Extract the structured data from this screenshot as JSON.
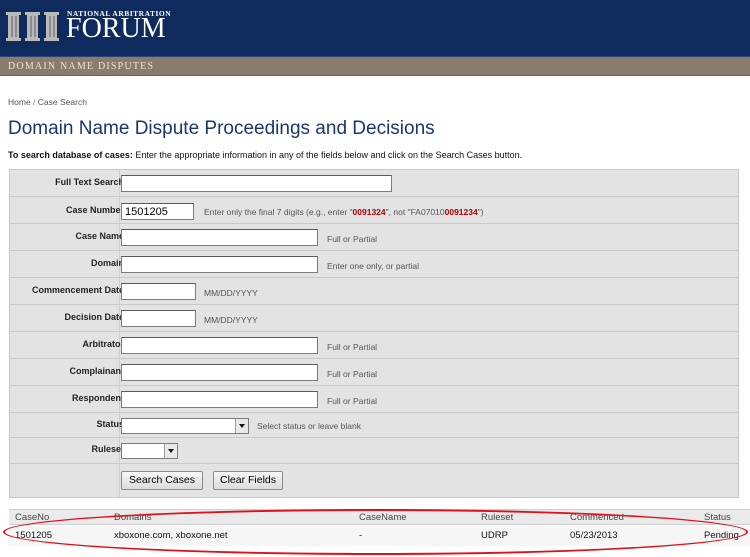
{
  "header": {
    "org_small": "NATIONAL ARBITRATION",
    "org_big": "FORUM",
    "section": "DOMAIN NAME DISPUTES"
  },
  "breadcrumb": {
    "home": "Home",
    "sep": " / ",
    "current": "Case Search"
  },
  "page": {
    "title": "Domain Name Dispute Proceedings and Decisions",
    "intro_bold": "To search database of cases:",
    "intro_text": " Enter the appropriate information in any of the fields below and click on the Search Cases button."
  },
  "form": {
    "full_text": {
      "label": "Full Text Search",
      "value": ""
    },
    "case_number": {
      "label": "Case Number",
      "value": "1501205",
      "hint_a": "Enter only the final 7 digits (e.g., enter \"",
      "hint_red1": "0091324",
      "hint_b": "\", not \"FA07010",
      "hint_red2": "0091234",
      "hint_c": "\")"
    },
    "case_name": {
      "label": "Case Name",
      "value": "",
      "hint": "Full or Partial"
    },
    "domain": {
      "label": "Domain",
      "value": "",
      "hint": "Enter one only, or partial"
    },
    "commencement": {
      "label": "Commencement Date",
      "value": "",
      "hint": "MM/DD/YYYY"
    },
    "decision": {
      "label": "Decision Date",
      "value": "",
      "hint": "MM/DD/YYYY"
    },
    "arbitrator": {
      "label": "Arbitrator",
      "value": "",
      "hint": "Full or Partial"
    },
    "complainant": {
      "label": "Complainant",
      "value": "",
      "hint": "Full or Partial"
    },
    "respondent": {
      "label": "Respondent",
      "value": "",
      "hint": "Full or Partial"
    },
    "status": {
      "label": "Status",
      "value": "",
      "hint": "Select status or leave blank"
    },
    "ruleset": {
      "label": "Ruleset",
      "value": ""
    },
    "search_button": "Search Cases",
    "clear_button": "Clear Fields"
  },
  "results": {
    "columns": [
      "CaseNo",
      "Domains",
      "CaseName",
      "Ruleset",
      "Commenced",
      "Status"
    ],
    "rows": [
      {
        "case_no": "1501205",
        "domains": "xboxone.com, xboxone.net",
        "case_name": "-",
        "ruleset": "UDRP",
        "commenced": "05/23/2013",
        "status": "Pending"
      }
    ]
  },
  "colors": {
    "header_navy": "#0f2a5c",
    "subbar_taupe": "#8a7c6c",
    "title_blue": "#1a3670",
    "hint_red": "#b00000",
    "highlight_red": "#e0101a"
  }
}
